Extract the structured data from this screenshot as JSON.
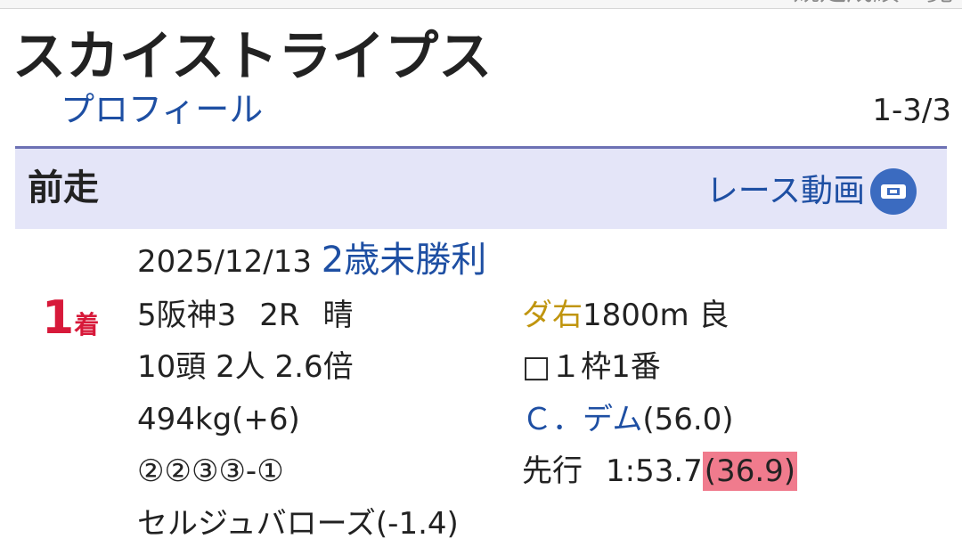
{
  "top_nav": {
    "link_label": "競走成績一覧"
  },
  "horse": {
    "name": "スカイストライプス",
    "profile_link": "プロフィール",
    "page_count": "1-3/3"
  },
  "section": {
    "title": "前走",
    "video_link": "レース動画",
    "video_icon": "video-camera-icon"
  },
  "race": {
    "finish_number": "1",
    "finish_unit": "着",
    "date": "2025/12/13",
    "race_name": "2歳未勝利",
    "venue": "5阪神3",
    "race_no": "2R",
    "weather": "晴",
    "surface": "ダ右",
    "distance": "1800m",
    "condition": "良",
    "field_info": "10頭 2人 2.6倍",
    "post": "□１枠1番",
    "weight": "494kg(+6)",
    "jockey": "Ｃ．デム",
    "jockey_weight": "(56.0)",
    "passing_order": "②②③③-①",
    "running_style": "先行",
    "time": "1:53.7",
    "last_3f": "(36.9)",
    "runner_up": "セルジュバローズ(-1.4)"
  },
  "colors": {
    "link_blue": "#1e4fa3",
    "finish_red": "#d7193a",
    "surface_gold": "#c0950e",
    "header_bg": "#e4e5f8",
    "header_border": "#6d71b4",
    "last3f_highlight": "#f07b8d"
  }
}
